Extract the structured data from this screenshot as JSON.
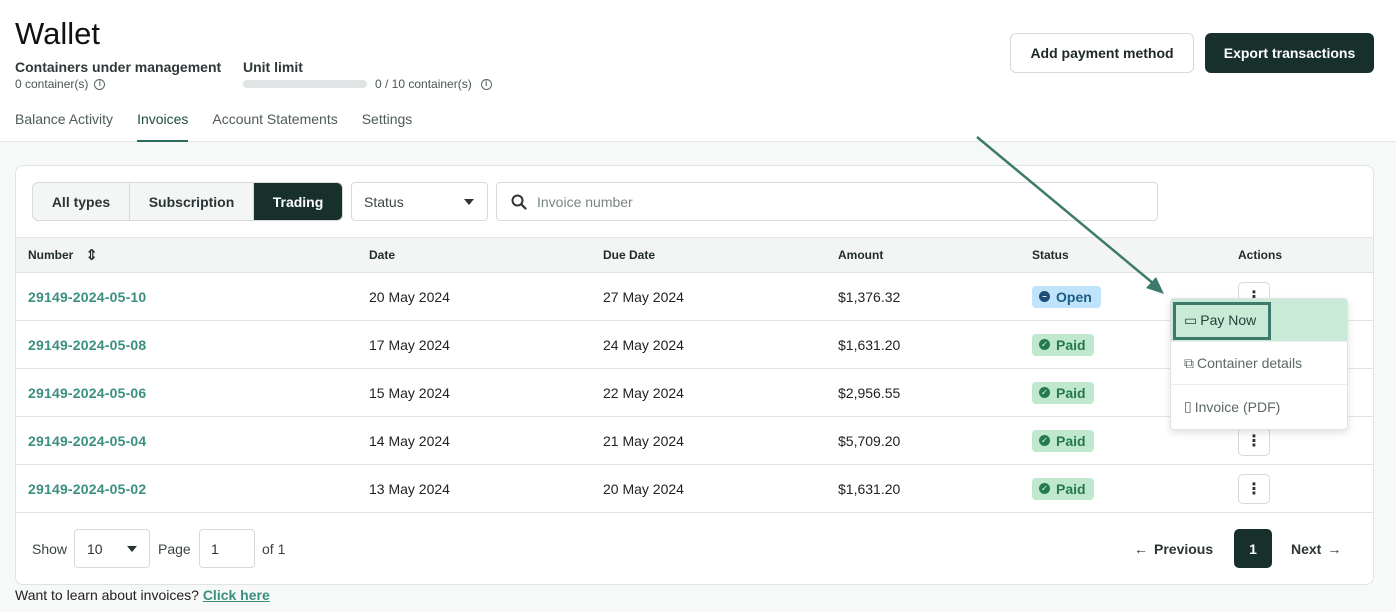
{
  "header": {
    "title": "Wallet",
    "containers_label": "Containers under management",
    "containers_value": "0 container(s)",
    "unit_limit_label": "Unit limit",
    "unit_limit_value": "0 / 10 container(s)",
    "unit_limit_fraction": 0.0,
    "info_symbol": "i",
    "add_payment_label": "Add payment method",
    "export_label": "Export transactions"
  },
  "tabs": [
    {
      "label": "Balance Activity",
      "active": false
    },
    {
      "label": "Invoices",
      "active": true
    },
    {
      "label": "Account Statements",
      "active": false
    },
    {
      "label": "Settings",
      "active": false
    }
  ],
  "filters": {
    "types": [
      {
        "label": "All types",
        "active": false
      },
      {
        "label": "Subscription",
        "active": false
      },
      {
        "label": "Trading",
        "active": true
      }
    ],
    "status_label": "Status",
    "search_placeholder": "Invoice number"
  },
  "table": {
    "columns": [
      "Number",
      "Date",
      "Due Date",
      "Amount",
      "Status",
      "Actions"
    ],
    "rows": [
      {
        "number": "29149-2024-05-10",
        "date": "20 May 2024",
        "due": "27 May 2024",
        "amount": "$1,376.32",
        "status": "Open",
        "status_symbol": "–"
      },
      {
        "number": "29149-2024-05-08",
        "date": "17 May 2024",
        "due": "24 May 2024",
        "amount": "$1,631.20",
        "status": "Paid",
        "status_symbol": "✓"
      },
      {
        "number": "29149-2024-05-06",
        "date": "15 May 2024",
        "due": "22 May 2024",
        "amount": "$2,956.55",
        "status": "Paid",
        "status_symbol": "✓"
      },
      {
        "number": "29149-2024-05-04",
        "date": "14 May 2024",
        "due": "21 May 2024",
        "amount": "$5,709.20",
        "status": "Paid",
        "status_symbol": "✓"
      },
      {
        "number": "29149-2024-05-02",
        "date": "13 May 2024",
        "due": "20 May 2024",
        "amount": "$1,631.20",
        "status": "Paid",
        "status_symbol": "✓"
      }
    ],
    "kebab_symbol": "⋮",
    "sort_symbol": "⇕"
  },
  "action_menu": {
    "items": [
      {
        "label": "Pay Now",
        "icon": "card-icon",
        "symbol": "▭"
      },
      {
        "label": "Container details",
        "icon": "external-link-icon",
        "symbol": "⧉"
      },
      {
        "label": "Invoice (PDF)",
        "icon": "document-icon",
        "symbol": "▯"
      }
    ]
  },
  "pagination": {
    "show_label": "Show",
    "page_size": "10",
    "page_label": "Page",
    "page_value": "1",
    "of_label": "of 1",
    "previous_label": "Previous",
    "current_page": "1",
    "next_label": "Next",
    "prev_arrow": "←",
    "next_arrow": "→"
  },
  "footer": {
    "learn_text": "Want to learn about invoices?",
    "learn_link": "Click here"
  },
  "colors": {
    "accent": "#3a8f7f",
    "dark": "#17302b",
    "annotation_arrow": "#3d7a6c"
  }
}
